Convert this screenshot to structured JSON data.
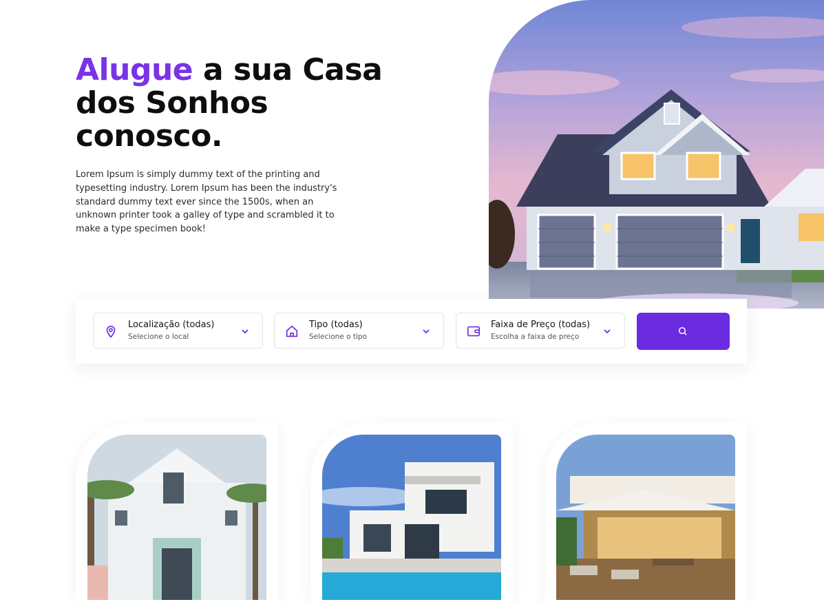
{
  "hero": {
    "title_accent": "Alugue",
    "title_rest_1": " a sua Casa",
    "title_line_2": "dos Sonhos",
    "title_line_3": "conosco.",
    "description": "Lorem Ipsum is simply dummy text of the printing and typesetting industry. Lorem Ipsum has been the industry's standard dummy text ever since the 1500s, when an unknown printer took a galley of type and scrambled it to make a type specimen book!"
  },
  "search": {
    "filters": [
      {
        "title": "Localização (todas)",
        "subtitle": "Selecione o local",
        "icon": "map-pin-icon"
      },
      {
        "title": "Tipo (todas)",
        "subtitle": "Selecione o tipo",
        "icon": "house-icon"
      },
      {
        "title": "Faixa de Preço (todas)",
        "subtitle": "Escolha a faixa de preço",
        "icon": "wallet-icon"
      }
    ],
    "button_icon": "search-icon"
  },
  "colors": {
    "accent": "#7a33e6",
    "button": "#6b2be0"
  },
  "listings": [
    {
      "image": "colonial-house-palms-photo"
    },
    {
      "image": "modern-villa-pool-photo"
    },
    {
      "image": "beach-house-deck-photo"
    }
  ]
}
